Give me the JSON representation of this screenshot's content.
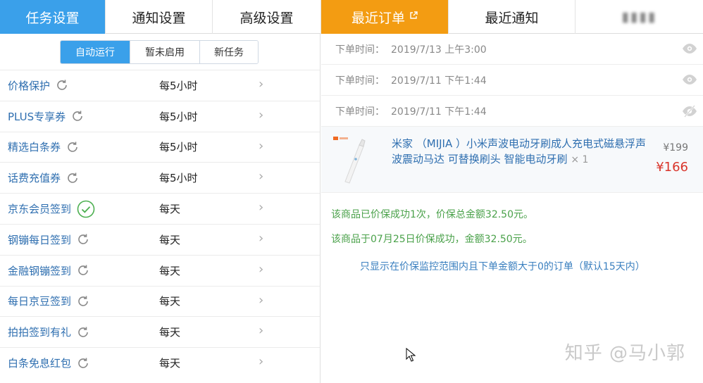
{
  "tabs": [
    {
      "label": "任务设置",
      "state": "active"
    },
    {
      "label": "通知设置",
      "state": "normal"
    },
    {
      "label": "高级设置",
      "state": "normal"
    },
    {
      "label": "最近订单",
      "state": "active",
      "icon": "external-link-icon"
    },
    {
      "label": "最近通知",
      "state": "normal"
    }
  ],
  "segments": [
    "自动运行",
    "暂未启用",
    "新任务"
  ],
  "tasks": [
    {
      "name": "价格保护",
      "freq": "每5小时",
      "status": "refresh"
    },
    {
      "name": "PLUS专享券",
      "freq": "每5小时",
      "status": "refresh"
    },
    {
      "name": "精选白条券",
      "freq": "每5小时",
      "status": "refresh"
    },
    {
      "name": "话费充值券",
      "freq": "每5小时",
      "status": "refresh"
    },
    {
      "name": "京东会员签到",
      "freq": "每天",
      "status": "done"
    },
    {
      "name": "钢镚每日签到",
      "freq": "每天",
      "status": "refresh"
    },
    {
      "name": "金融钢镚签到",
      "freq": "每天",
      "status": "refresh"
    },
    {
      "name": "每日京豆签到",
      "freq": "每天",
      "status": "refresh"
    },
    {
      "name": "拍拍签到有礼",
      "freq": "每天",
      "status": "refresh"
    },
    {
      "name": "白条免息红包",
      "freq": "每天",
      "status": "refresh"
    }
  ],
  "orders": [
    {
      "label": "下单时间：",
      "time": "2019/7/13 上午3:00",
      "eye": "eye-icon"
    },
    {
      "label": "下单时间：",
      "time": "2019/7/11 下午1:44",
      "eye": "eye-icon"
    },
    {
      "label": "下单时间：",
      "time": "2019/7/11 下午1:44",
      "eye": "eye-off-icon"
    }
  ],
  "product": {
    "title": "米家 （MIJIA ）小米声波电动牙刷成人充电式磁悬浮声波震动马达 可替换刷头 智能电动牙刷",
    "qty": "× 1",
    "old_price": "¥199",
    "new_price": "¥166"
  },
  "messages": [
    "该商品已价保成功1次，价保总金额32.50元。",
    "该商品于07月25日价保成功，金额32.50元。"
  ],
  "note": "只显示在价保监控范围内且下单金额大于0的订单（默认15天内）",
  "watermark": "知乎 @马小郭",
  "colors": {
    "blue": "#3aa0ea",
    "orange": "#f39c12",
    "link": "#2f6fb0",
    "green": "#4aa14a",
    "red": "#d9352b"
  }
}
